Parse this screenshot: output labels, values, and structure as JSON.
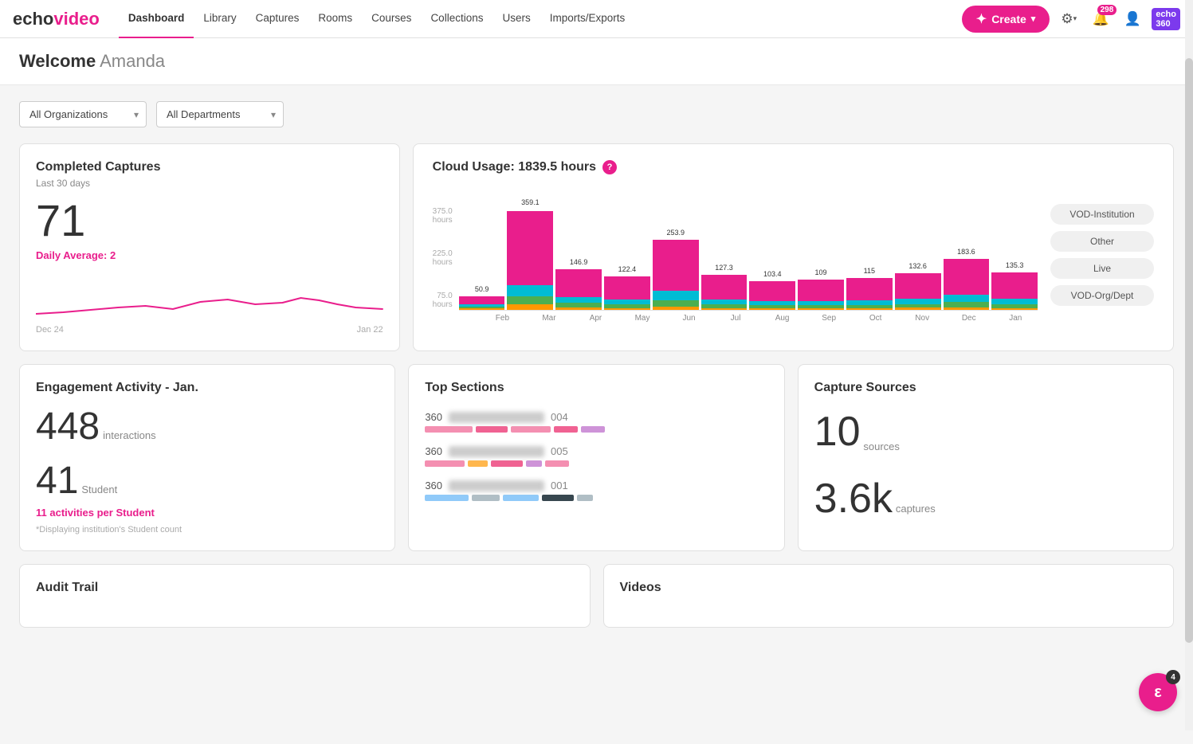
{
  "nav": {
    "logo_echo": "echo",
    "logo_video": "video",
    "links": [
      {
        "label": "Dashboard",
        "active": true
      },
      {
        "label": "Library",
        "active": false
      },
      {
        "label": "Captures",
        "active": false
      },
      {
        "label": "Rooms",
        "active": false
      },
      {
        "label": "Courses",
        "active": false
      },
      {
        "label": "Collections",
        "active": false
      },
      {
        "label": "Users",
        "active": false
      },
      {
        "label": "Imports/Exports",
        "active": false
      }
    ],
    "create_label": "Create",
    "notification_count": "298",
    "chat_count": "4"
  },
  "page_header": {
    "welcome": "Welcome",
    "user": "Amanda"
  },
  "filters": {
    "org_label": "All Organizations",
    "dept_label": "All Departments"
  },
  "completed_captures": {
    "title": "Completed Captures",
    "subtitle": "Last 30 days",
    "count": "71",
    "daily_avg": "Daily Average: 2",
    "date_start": "Dec 24",
    "date_end": "Jan 22"
  },
  "cloud_usage": {
    "title": "Cloud Usage: 1839.5 hours",
    "y_labels": [
      "375.0 hours",
      "225.0 hours",
      "75.0 hours"
    ],
    "bars": [
      {
        "month": "Feb",
        "total": 50.9,
        "vod_inst": 30,
        "other": 8,
        "live": 6,
        "vod_org": 6
      },
      {
        "month": "Mar",
        "total": 359.1,
        "vod_inst": 270,
        "other": 40,
        "live": 30,
        "vod_org": 19
      },
      {
        "month": "Apr",
        "total": 146.9,
        "vod_inst": 100,
        "other": 22,
        "live": 16,
        "vod_org": 9
      },
      {
        "month": "May",
        "total": 122.4,
        "vod_inst": 85,
        "other": 18,
        "live": 12,
        "vod_org": 7
      },
      {
        "month": "Jun",
        "total": 253.9,
        "vod_inst": 185,
        "other": 35,
        "live": 22,
        "vod_org": 12
      },
      {
        "month": "Jul",
        "total": 127.3,
        "vod_inst": 90,
        "other": 18,
        "live": 12,
        "vod_org": 7
      },
      {
        "month": "Aug",
        "total": 103.4,
        "vod_inst": 72,
        "other": 15,
        "live": 10,
        "vod_org": 6
      },
      {
        "month": "Sep",
        "total": 109.0,
        "vod_inst": 76,
        "other": 16,
        "live": 11,
        "vod_org": 6
      },
      {
        "month": "Oct",
        "total": 115.0,
        "vod_inst": 80,
        "other": 17,
        "live": 12,
        "vod_org": 6
      },
      {
        "month": "Nov",
        "total": 132.6,
        "vod_inst": 93,
        "other": 19,
        "live": 13,
        "vod_org": 8
      },
      {
        "month": "Dec",
        "total": 183.6,
        "vod_inst": 130,
        "other": 26,
        "live": 18,
        "vod_org": 10
      },
      {
        "month": "Jan",
        "total": 135.3,
        "vod_inst": 95,
        "other": 20,
        "live": 13,
        "vod_org": 7
      }
    ],
    "legend": [
      {
        "label": "VOD-Institution",
        "color": "#e91e8c"
      },
      {
        "label": "Other",
        "color": "#00bcd4"
      },
      {
        "label": "Live",
        "color": "#4caf50"
      },
      {
        "label": "VOD-Org/Dept",
        "color": "#ff9800"
      }
    ],
    "colors": {
      "vod_inst": "#e91e8c",
      "other": "#00bcd4",
      "live": "#4caf50",
      "vod_org": "#ff9800"
    }
  },
  "engagement": {
    "title": "Engagement Activity - Jan.",
    "interactions_count": "448",
    "interactions_label": "interactions",
    "student_count": "41",
    "student_label": "Student",
    "activities_per_student": "11 activities per Student",
    "disclaimer": "*Displaying institution's Student count"
  },
  "top_sections": {
    "title": "Top Sections",
    "sections": [
      {
        "prefix": "360",
        "suffix": "004"
      },
      {
        "prefix": "360",
        "suffix": "005"
      },
      {
        "prefix": "360",
        "suffix": "001"
      }
    ]
  },
  "capture_sources": {
    "title": "Capture Sources",
    "sources_count": "10",
    "sources_label": "sources",
    "captures_count": "3.6k",
    "captures_label": "captures"
  },
  "audit_trail": {
    "title": "Audit Trail"
  },
  "videos": {
    "title": "Videos"
  }
}
